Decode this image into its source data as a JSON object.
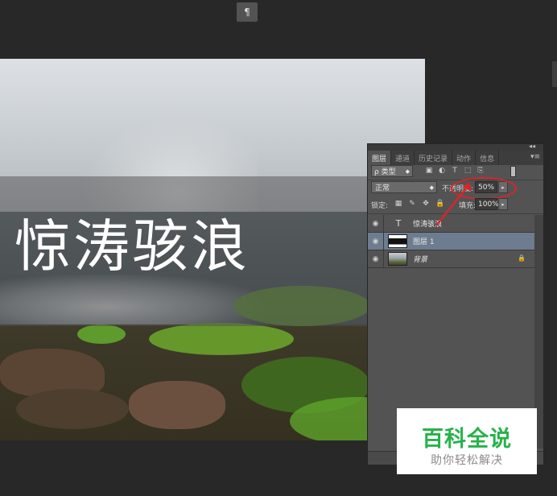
{
  "toolbar": {
    "paragraph_icon": "¶"
  },
  "canvas": {
    "title_text": "惊涛骇浪"
  },
  "panel": {
    "strip_glyph": "◂◂",
    "tabs": [
      {
        "label": "图层",
        "active": true
      },
      {
        "label": "通道",
        "active": false
      },
      {
        "label": "历史记录",
        "active": false
      },
      {
        "label": "动作",
        "active": false
      },
      {
        "label": "信息",
        "active": false
      }
    ],
    "menu_icon": "▾≡",
    "filter": {
      "kind_label": "ρ 类型",
      "icons": [
        "image-icon",
        "adjustment-icon",
        "type-icon",
        "shape-icon",
        "smart-object-icon"
      ],
      "icon_glyphs": [
        "▣",
        "◐",
        "T",
        "⬚",
        "⎘"
      ]
    },
    "blend": {
      "mode": "正常",
      "opacity_label": "不透明度:",
      "opacity_value": "50%"
    },
    "lock": {
      "label": "锁定:",
      "fill_label": "填充:",
      "fill_value": "100%",
      "icon_glyphs": [
        "▦",
        "✎",
        "✥",
        "🔒"
      ]
    },
    "layers": [
      {
        "name": "惊涛骇浪",
        "type": "text",
        "selected": false,
        "visible": true
      },
      {
        "name": "图层 1",
        "type": "mask",
        "selected": true,
        "visible": true
      },
      {
        "name": "背景",
        "type": "photo",
        "selected": false,
        "visible": true,
        "locked": true
      }
    ],
    "eye_glyph": "◉",
    "text_layer_glyph": "T",
    "lock_glyph": "🔒",
    "caret_glyph": "◆",
    "arrow_glyph": "▸"
  },
  "watermark": {
    "main": "百科全说",
    "sub": "助你轻松解决"
  },
  "colors": {
    "accent_red": "#d8262b",
    "selected_layer": "#6d7c8f",
    "watermark_green": "#27b24a"
  }
}
